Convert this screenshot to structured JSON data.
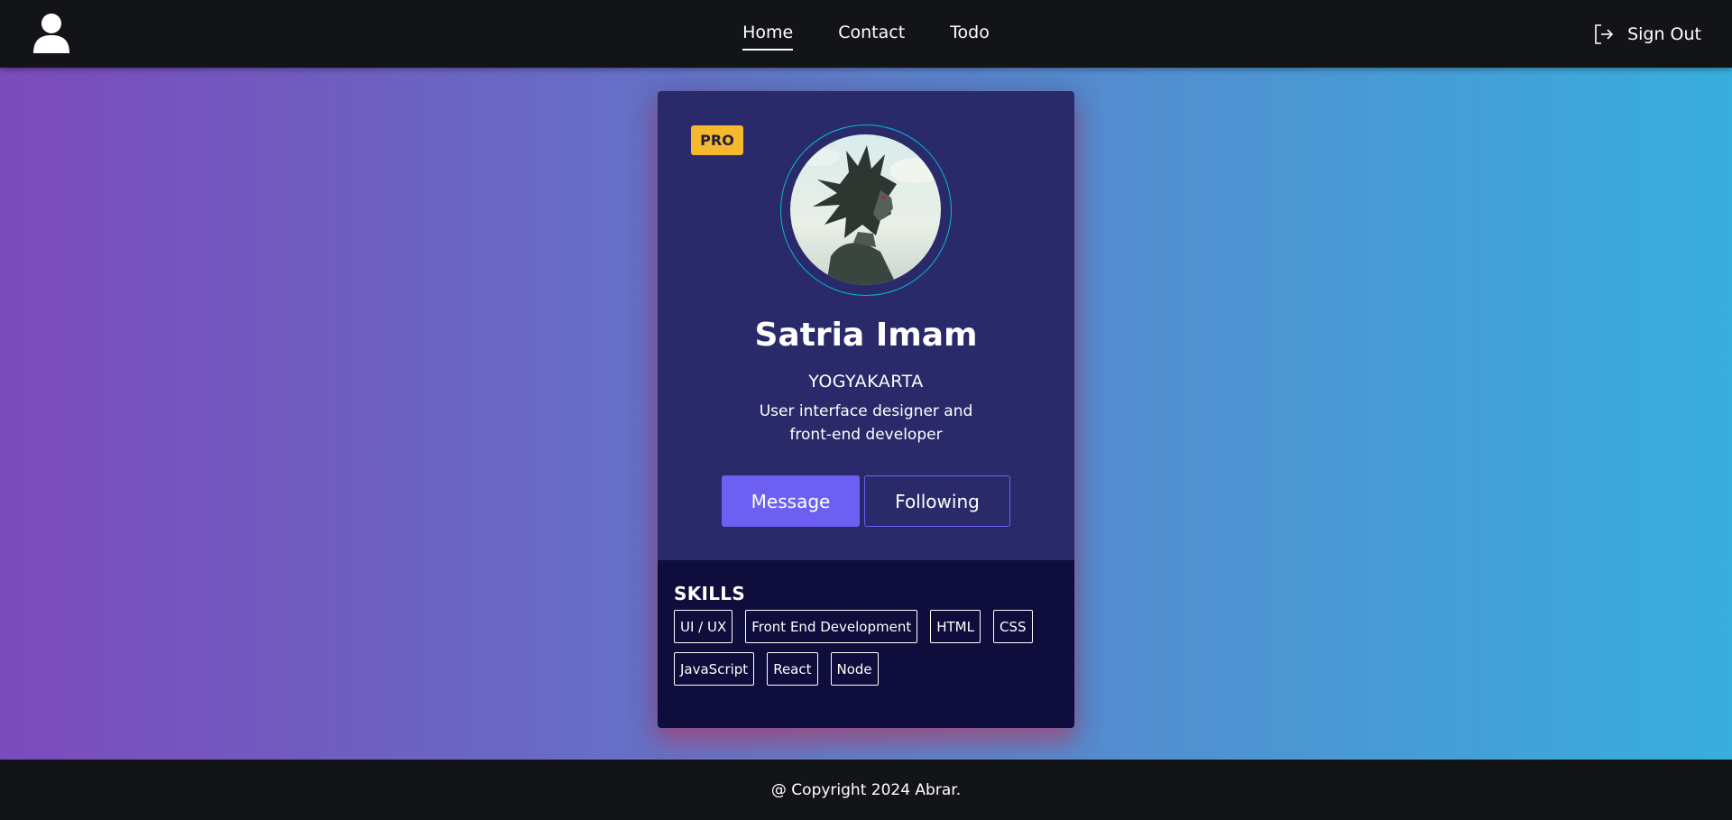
{
  "navbar": {
    "avatar_icon": "user-icon",
    "links": [
      {
        "label": "Home",
        "active": true
      },
      {
        "label": "Contact",
        "active": false
      },
      {
        "label": "Todo",
        "active": false
      }
    ],
    "signout_label": "Sign Out",
    "signout_icon": "sign-out-icon"
  },
  "profile": {
    "badge": "PRO",
    "name": "Satria Imam",
    "city": "YOGYAKARTA",
    "bio_line1": "User interface designer and",
    "bio_line2": "front-end developer",
    "message_label": "Message",
    "following_label": "Following"
  },
  "skills": {
    "title": "SKILLS",
    "items": [
      "UI / UX",
      "Front End Development",
      "HTML",
      "CSS",
      "JavaScript",
      "React",
      "Node"
    ]
  },
  "footer": {
    "text": "@ Copyright 2024 Abrar."
  },
  "colors": {
    "navbar_bg": "#131418",
    "card_top": "#2a2a6a",
    "card_bottom": "#0e0d3b",
    "accent": "#6d5ff2",
    "badge": "#f6b82f",
    "ring": "#02bbd6"
  }
}
